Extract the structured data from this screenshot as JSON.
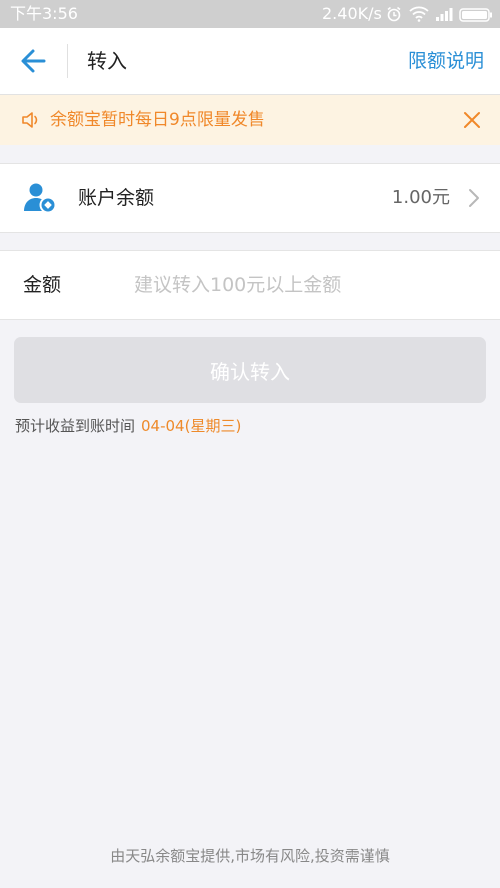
{
  "status_bar": {
    "time": "下午3:56",
    "network_speed": "2.40K/s"
  },
  "nav": {
    "title": "转入",
    "action": "限额说明"
  },
  "notice": {
    "text": "余额宝暂时每日9点限量发售"
  },
  "balance": {
    "label": "账户余额",
    "value": "1.00元"
  },
  "amount": {
    "label": "金额",
    "placeholder": "建议转入100元以上金额"
  },
  "confirm_label": "确认转入",
  "eta": {
    "label": "预计收益到账时间",
    "date": "04-04(星期三)"
  },
  "footer": "由天弘余额宝提供,市场有风险,投资需谨慎",
  "colors": {
    "accent": "#2a8fd6",
    "notice": "#f0882a",
    "button_disabled": "#dfdfe3"
  }
}
